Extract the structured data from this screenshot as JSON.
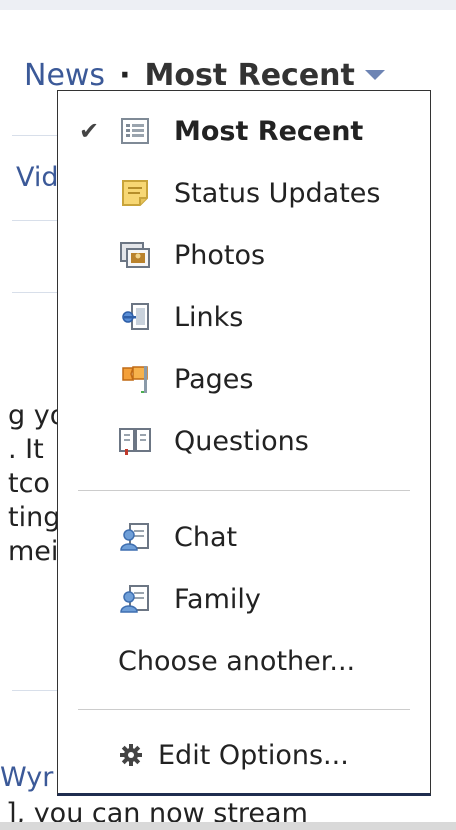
{
  "header": {
    "news_label": "News",
    "separator": "·",
    "sort_label": "Most Recent"
  },
  "background": {
    "lines": [
      "Vid",
      "g yo",
      ". It",
      "tco",
      "ting",
      "mei",
      "Wyr",
      "], you can now stream"
    ]
  },
  "menu": {
    "sort_items": [
      {
        "label": "Most Recent",
        "checked": true,
        "icon": "news-feed-icon"
      },
      {
        "label": "Status Updates",
        "checked": false,
        "icon": "status-note-icon"
      },
      {
        "label": "Photos",
        "checked": false,
        "icon": "photo-icon"
      },
      {
        "label": "Links",
        "checked": false,
        "icon": "link-icon"
      },
      {
        "label": "Pages",
        "checked": false,
        "icon": "flag-icon"
      },
      {
        "label": "Questions",
        "checked": false,
        "icon": "question-book-icon"
      }
    ],
    "list_items": [
      {
        "label": "Chat",
        "icon": "friend-list-icon"
      },
      {
        "label": "Family",
        "icon": "friend-list-icon"
      }
    ],
    "choose_another": "Choose another...",
    "edit_options": "Edit Options...",
    "check_glyph": "✔"
  },
  "colors": {
    "link_blue": "#3b5998",
    "caret_blue": "#6d84b4",
    "page_background": "#edeff4"
  }
}
